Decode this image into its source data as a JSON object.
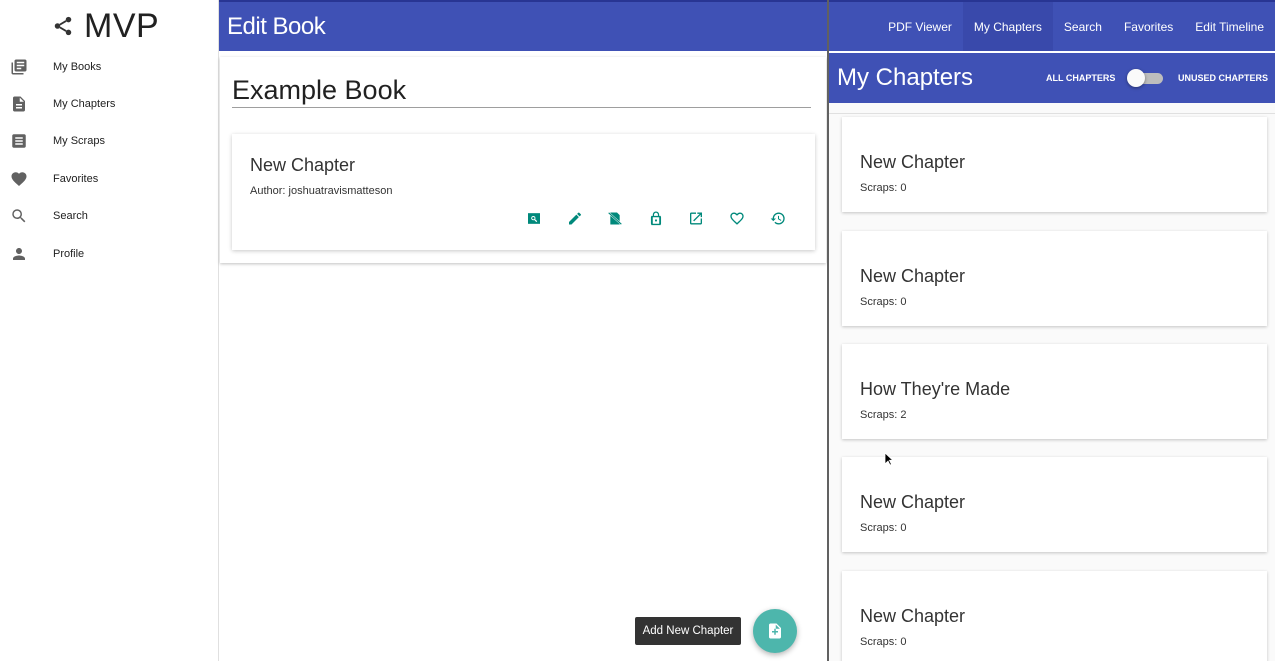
{
  "app": {
    "logo_text": "MVP"
  },
  "sidebar": {
    "items": [
      {
        "label": "My Books",
        "icon": "library-books-icon"
      },
      {
        "label": "My Chapters",
        "icon": "document-icon"
      },
      {
        "label": "My Scraps",
        "icon": "list-icon"
      },
      {
        "label": "Favorites",
        "icon": "heart-icon"
      },
      {
        "label": "Search",
        "icon": "search-icon"
      },
      {
        "label": "Profile",
        "icon": "person-icon"
      }
    ]
  },
  "edit_book": {
    "header_title": "Edit Book",
    "book_title": "Example Book",
    "chapter": {
      "title": "New Chapter",
      "author": "Author: joshuatravismatteson",
      "actions": [
        "view-icon",
        "edit-icon",
        "hide-icon",
        "lock-icon",
        "open-external-icon",
        "favorite-icon",
        "history-icon"
      ]
    },
    "add_tooltip": "Add New Chapter"
  },
  "top_nav": {
    "tabs": [
      {
        "label": "PDF Viewer",
        "active": false
      },
      {
        "label": "My Chapters",
        "active": true
      },
      {
        "label": "Search",
        "active": false
      },
      {
        "label": "Favorites",
        "active": false
      },
      {
        "label": "Edit Timeline",
        "active": false
      }
    ]
  },
  "my_chapters": {
    "title": "My Chapters",
    "toggle_left_label": "ALL CHAPTERS",
    "toggle_right_label": "UNUSED CHAPTERS",
    "toggle_on": false,
    "items": [
      {
        "title": "New Chapter",
        "scraps": "Scraps: 0"
      },
      {
        "title": "New Chapter",
        "scraps": "Scraps: 0"
      },
      {
        "title": "How They're Made",
        "scraps": "Scraps: 2"
      },
      {
        "title": "New Chapter",
        "scraps": "Scraps: 0"
      },
      {
        "title": "New Chapter",
        "scraps": "Scraps: 0"
      }
    ]
  },
  "colors": {
    "primary": "#3f51b5",
    "primary_dark": "#283593",
    "accent_teal": "#00897b",
    "fab": "#4db6ac"
  }
}
